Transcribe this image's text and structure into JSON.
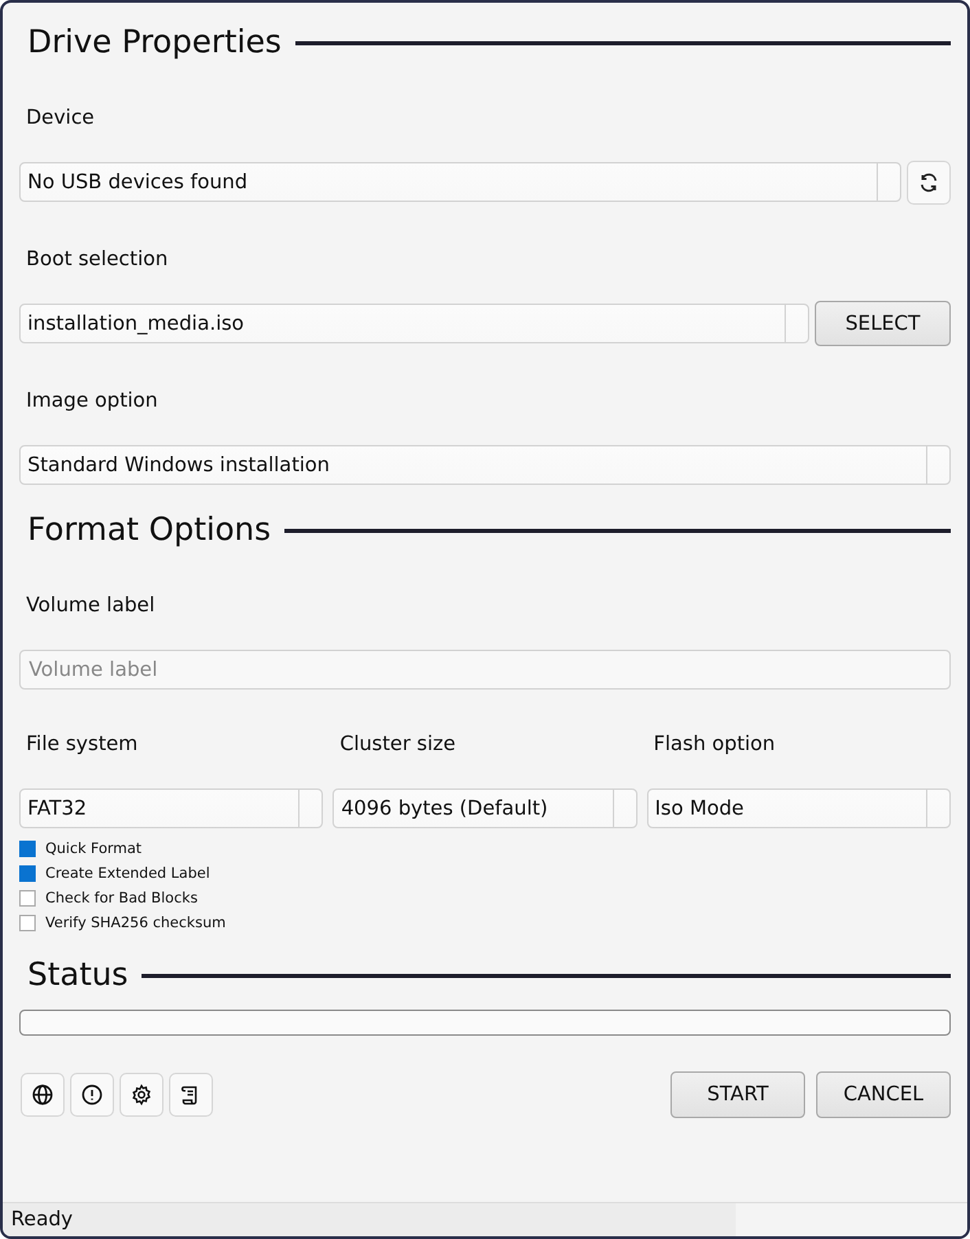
{
  "sections": [
    {
      "title": "Drive Properties"
    },
    {
      "title": "Format Options"
    },
    {
      "title": "Status"
    }
  ],
  "device": {
    "label": "Device",
    "value": "No USB devices found"
  },
  "boot_selection": {
    "label": "Boot selection",
    "value": "installation_media.iso",
    "button": "SELECT"
  },
  "image_option": {
    "label": "Image option",
    "value": "Standard Windows installation"
  },
  "volume_label": {
    "label": "Volume label",
    "placeholder": "Volume label"
  },
  "format_fields": [
    {
      "label": "File system",
      "value": "FAT32"
    },
    {
      "label": "Cluster size",
      "value": "4096 bytes (Default)"
    },
    {
      "label": "Flash option",
      "value": "Iso Mode"
    }
  ],
  "options": [
    {
      "label": "Quick Format",
      "checked": true
    },
    {
      "label": "Create Extended Label",
      "checked": true
    },
    {
      "label": "Check for Bad Blocks",
      "checked": false
    },
    {
      "label": "Verify SHA256 checksum",
      "checked": false
    }
  ],
  "buttons": [
    "START",
    "CANCEL"
  ],
  "status_bar": "Ready"
}
